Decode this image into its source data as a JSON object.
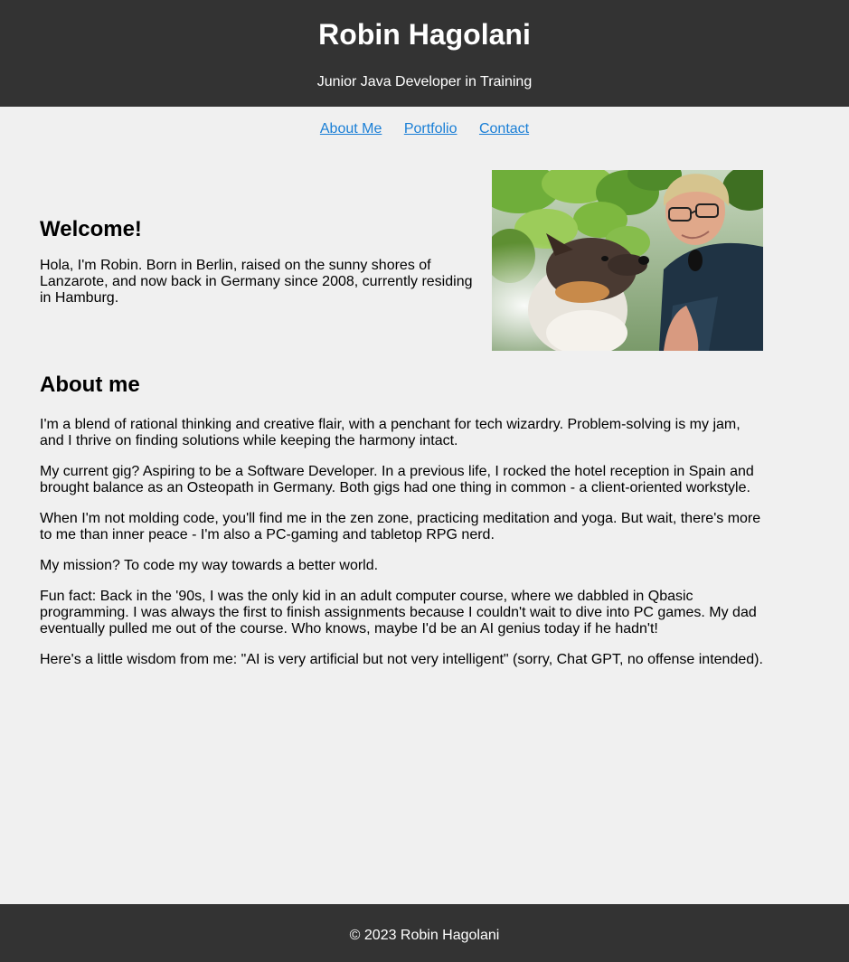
{
  "header": {
    "title": "Robin Hagolani",
    "subtitle": "Junior Java Developer in Training"
  },
  "nav": {
    "items": [
      {
        "label": "About Me"
      },
      {
        "label": "Portfolio"
      },
      {
        "label": "Contact"
      }
    ]
  },
  "welcome": {
    "heading": "Welcome!",
    "text": "Hola, I'm Robin. Born in Berlin, raised on the sunny shores of Lanzarote, and now back in Germany since 2008, currently residing in Hamburg.",
    "photo_alt": "Selfie of Robin with a dog under green leaves"
  },
  "about": {
    "heading": "About me",
    "paragraphs": [
      "I'm a blend of rational thinking and creative flair, with a penchant for tech wizardry. Problem-solving is my jam, and I thrive on finding solutions while keeping the harmony intact.",
      "My current gig? Aspiring to be a Software Developer. In a previous life, I rocked the hotel reception in Spain and brought balance as an Osteopath in Germany. Both gigs had one thing in common - a client-oriented workstyle.",
      "When I'm not molding code, you'll find me in the zen zone, practicing meditation and yoga. But wait, there's more to me than inner peace - I'm also a PC-gaming and tabletop RPG nerd.",
      "My mission? To code my way towards a better world.",
      "Fun fact: Back in the '90s, I was the only kid in an adult computer course, where we dabbled in Qbasic programming. I was always the first to finish assignments because I couldn't wait to dive into PC games. My dad eventually pulled me out of the course. Who knows, maybe I'd be an AI genius today if he hadn't!",
      "Here's a little wisdom from me: \"AI is very artificial but not very intelligent\" (sorry, Chat GPT, no offense intended)."
    ]
  },
  "footer": {
    "text": "© 2023 Robin Hagolani"
  },
  "colors": {
    "header_bg": "#333333",
    "page_bg": "#f0f0f0",
    "link": "#1a7fd6",
    "footer_bg": "#333333"
  }
}
